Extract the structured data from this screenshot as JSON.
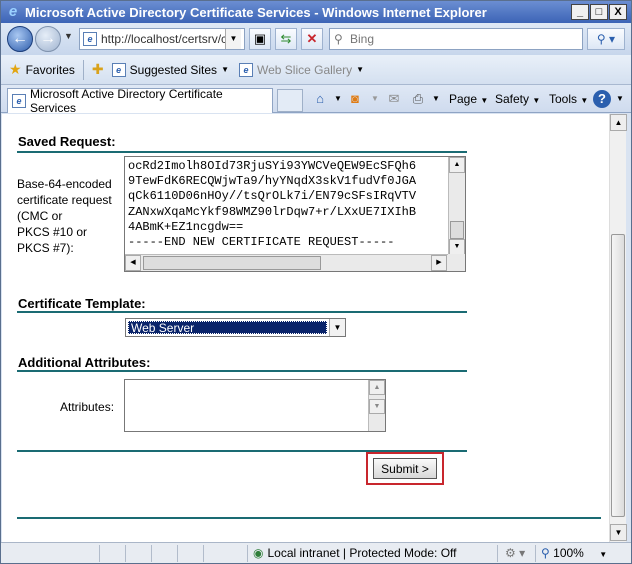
{
  "window": {
    "title": "Microsoft Active Directory Certificate Services - Windows Internet Explorer",
    "app_icon": "ie-icon",
    "controls": {
      "minimize": "_",
      "maximize": "□",
      "close": "X"
    }
  },
  "address_bar": {
    "url": "http://localhost/certsrv/c",
    "search_placeholder": "Bing"
  },
  "favorites_bar": {
    "favorites_label": "Favorites",
    "suggested_sites_label": "Suggested Sites",
    "web_slice_gallery_label": "Web Slice Gallery"
  },
  "tab": {
    "title": "Microsoft Active Directory Certificate Services"
  },
  "command_bar": {
    "page_label": "Page",
    "safety_label": "Safety",
    "tools_label": "Tools"
  },
  "form": {
    "saved_request_heading": "Saved Request:",
    "base64_label_lines": [
      "Base-64-encoded",
      "certificate request",
      "(CMC or",
      "PKCS #10 or",
      "PKCS #7):"
    ],
    "request_text": "ocRd2Imolh8OId73RjuSYi93YWCVeQEW9EcSFQh6\n9TewFdK6RECQWjwTa9/hyYNqdX3skV1fudVf0JGA\nqCk6110D06nHOy//tsQrOLk7i/EN79cSFsIRqVTV\nZANxwXqaMcYkf98WMZ90lrDqw7+r/LXxUE7IXIhB\n4ABmK+EZ1ncgdw==\n-----END NEW CERTIFICATE REQUEST-----",
    "certificate_template_heading": "Certificate Template:",
    "certificate_template_value": "Web Server",
    "additional_attributes_heading": "Additional Attributes:",
    "attributes_label": "Attributes:",
    "submit_label": "Submit >"
  },
  "status_bar": {
    "zone_text": "Local intranet | Protected Mode: Off",
    "zoom": "100%"
  }
}
